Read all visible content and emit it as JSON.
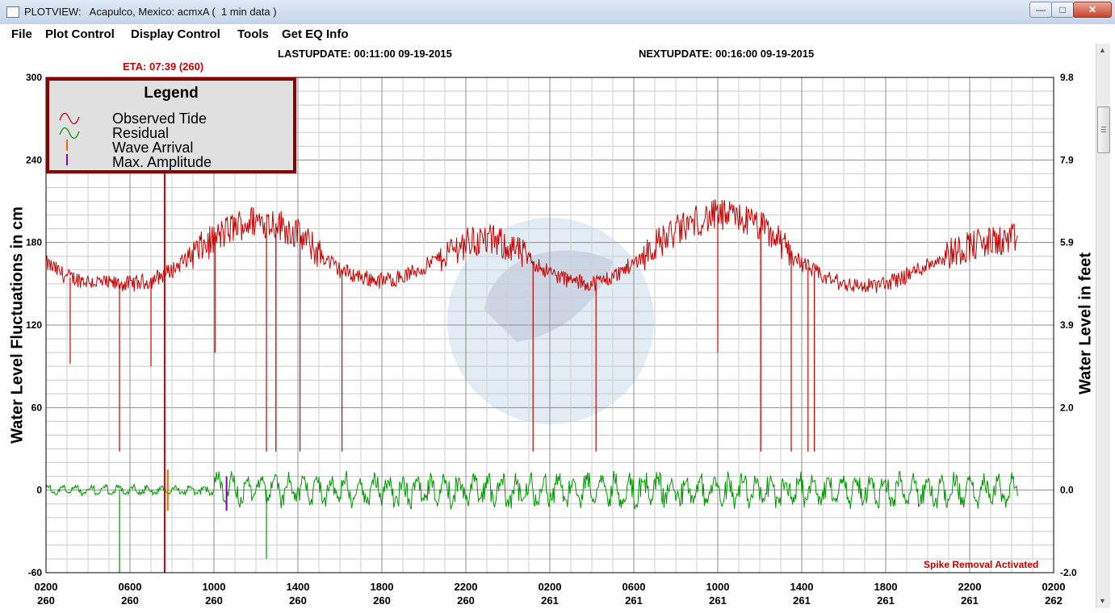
{
  "window": {
    "title": "PLOTVIEW:   Acapulco, Mexico: acmxA (  1 min data )",
    "controls": {
      "minimize": "—",
      "maximize": "□",
      "close": "✕"
    }
  },
  "menu": [
    "File",
    "Plot Control",
    "Display Control",
    "Tools",
    "Get EQ Info"
  ],
  "header": {
    "last_update": "LASTUPDATE: 00:11:00 09-19-2015",
    "next_update": "NEXTUPDATE: 00:16:00 09-19-2015",
    "eta": "ETA: 07:39 (260)",
    "spike_removal": "Spike Removal Activated"
  },
  "legend": {
    "title": "Legend",
    "items": [
      {
        "label": "Observed Tide",
        "color": "#cc0000",
        "icon": "wave-icon"
      },
      {
        "label": "Residual",
        "color": "#009900",
        "icon": "wave-icon"
      },
      {
        "label": "Wave Arrival",
        "color": "#e07000",
        "icon": "tick-icon"
      },
      {
        "label": "Max. Amplitude",
        "color": "#8800aa",
        "icon": "tick-icon"
      }
    ]
  },
  "chart_data": {
    "type": "line",
    "ylabel": "Water Level Fluctuations in cm",
    "ylabel_right": "Water Level in feet",
    "ylim": [
      -60,
      300
    ],
    "yticks": [
      -60,
      0,
      60,
      120,
      180,
      240,
      300
    ],
    "yticks_right": [
      "-2.0",
      "0.0",
      "2.0",
      "3.9",
      "5.9",
      "7.9",
      "9.8"
    ],
    "x_hours_range": [
      2,
      50
    ],
    "xticks": [
      {
        "hour": "0200",
        "day": "260"
      },
      {
        "hour": "0600",
        "day": "260"
      },
      {
        "hour": "1000",
        "day": "260"
      },
      {
        "hour": "1400",
        "day": "260"
      },
      {
        "hour": "1800",
        "day": "260"
      },
      {
        "hour": "2200",
        "day": "260"
      },
      {
        "hour": "0200",
        "day": "261"
      },
      {
        "hour": "0600",
        "day": "261"
      },
      {
        "hour": "1000",
        "day": "261"
      },
      {
        "hour": "1400",
        "day": "261"
      },
      {
        "hour": "1800",
        "day": "261"
      },
      {
        "hour": "2200",
        "day": "261"
      },
      {
        "hour": "0200",
        "day": "262"
      }
    ],
    "grid": true,
    "legend_position": "top-left",
    "series": [
      {
        "name": "Observed Tide",
        "color": "#cc0000",
        "x": [
          2,
          3,
          4,
          5,
          6,
          7,
          8,
          9,
          10,
          11,
          12,
          13,
          14,
          15,
          16,
          17,
          18,
          19,
          20,
          21,
          22,
          23,
          24,
          25,
          26,
          27,
          28,
          29,
          30,
          31,
          32,
          33,
          34,
          35,
          36,
          37,
          38,
          39,
          40,
          41,
          42,
          43,
          44,
          45,
          46,
          47,
          48,
          48.3
        ],
        "y": [
          165,
          155,
          152,
          150,
          150,
          152,
          160,
          172,
          182,
          192,
          196,
          194,
          186,
          172,
          160,
          155,
          152,
          155,
          162,
          172,
          180,
          182,
          178,
          168,
          158,
          152,
          150,
          155,
          165,
          178,
          188,
          196,
          200,
          198,
          192,
          180,
          165,
          155,
          150,
          148,
          150,
          156,
          164,
          172,
          178,
          180,
          182,
          182
        ]
      },
      {
        "name": "Residual",
        "color": "#009900",
        "x": [
          2,
          3,
          4,
          5,
          6,
          7,
          8,
          9,
          10,
          11,
          12,
          13,
          14,
          15,
          16,
          17,
          18,
          19,
          20,
          21,
          22,
          23,
          24,
          25,
          26,
          27,
          28,
          29,
          30,
          31,
          32,
          33,
          34,
          35,
          36,
          37,
          38,
          39,
          40,
          41,
          42,
          43,
          44,
          45,
          46,
          47,
          48,
          48.3
        ],
        "y": [
          0,
          0,
          0,
          0,
          0,
          0,
          0,
          0,
          0,
          0,
          0,
          0,
          0,
          0,
          0,
          0,
          0,
          0,
          0,
          0,
          0,
          0,
          0,
          0,
          0,
          0,
          0,
          0,
          0,
          0,
          0,
          0,
          0,
          0,
          0,
          0,
          0,
          0,
          0,
          0,
          0,
          0,
          0,
          0,
          0,
          0,
          0,
          0
        ]
      }
    ],
    "tide_spikes": [
      {
        "x": 3.15,
        "y": 92
      },
      {
        "x": 5.5,
        "y": 28
      },
      {
        "x": 7.0,
        "y": 90
      },
      {
        "x": 10.05,
        "y": 100
      },
      {
        "x": 12.5,
        "y": 28
      },
      {
        "x": 12.95,
        "y": 28
      },
      {
        "x": 14.1,
        "y": 28
      },
      {
        "x": 16.1,
        "y": 28
      },
      {
        "x": 25.2,
        "y": 28
      },
      {
        "x": 28.2,
        "y": 28
      },
      {
        "x": 34.0,
        "y": 100
      },
      {
        "x": 36.05,
        "y": 28
      },
      {
        "x": 37.5,
        "y": 28
      },
      {
        "x": 38.3,
        "y": 28
      },
      {
        "x": 38.6,
        "y": 28
      }
    ],
    "residual_spikes": [
      {
        "x": 5.5,
        "y": -60
      },
      {
        "x": 12.5,
        "y": -50
      }
    ],
    "residual_amplitude": 13,
    "eta_hour": 7.65,
    "wave_arrival_hour": 7.8,
    "max_amplitude_hour": 10.6
  }
}
